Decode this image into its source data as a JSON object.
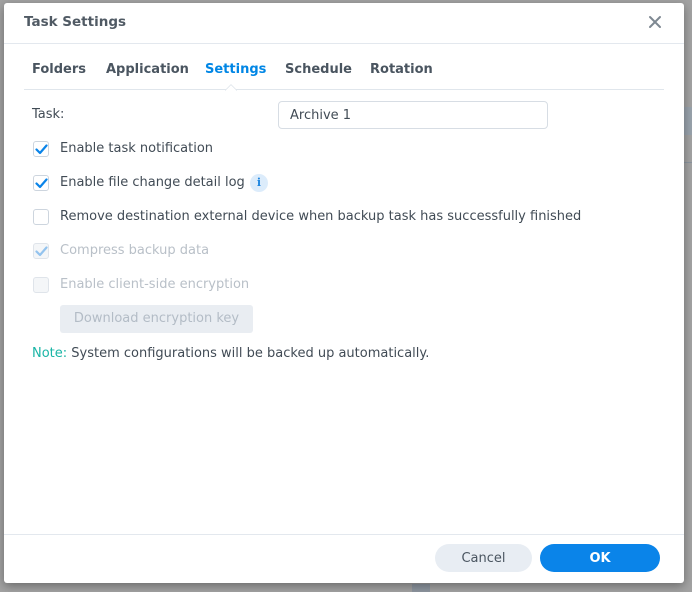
{
  "dialog": {
    "title": "Task Settings",
    "close_icon": "close-icon"
  },
  "tabs": [
    {
      "label": "Folders",
      "active": false
    },
    {
      "label": "Application",
      "active": false
    },
    {
      "label": "Settings",
      "active": true
    },
    {
      "label": "Schedule",
      "active": false
    },
    {
      "label": "Rotation",
      "active": false
    }
  ],
  "form": {
    "task_label": "Task:",
    "task_value": "Archive 1",
    "options": [
      {
        "label": "Enable task notification",
        "checked": true,
        "disabled": false
      },
      {
        "label": "Enable file change detail log",
        "checked": true,
        "disabled": false,
        "info_icon": "info-icon"
      },
      {
        "label": "Remove destination external device when backup task has successfully finished",
        "checked": false,
        "disabled": false
      },
      {
        "label": "Compress backup data",
        "checked": true,
        "disabled": true
      },
      {
        "label": "Enable client-side encryption",
        "checked": false,
        "disabled": true
      }
    ],
    "download_key_label": "Download encryption key",
    "note_prefix": "Note:",
    "note_text": " System configurations will be backed up automatically."
  },
  "footer": {
    "cancel_label": "Cancel",
    "ok_label": "OK"
  },
  "colors": {
    "accent": "#0a84e9",
    "active_tab": "#0086e5",
    "note": "#1bb5a6"
  }
}
